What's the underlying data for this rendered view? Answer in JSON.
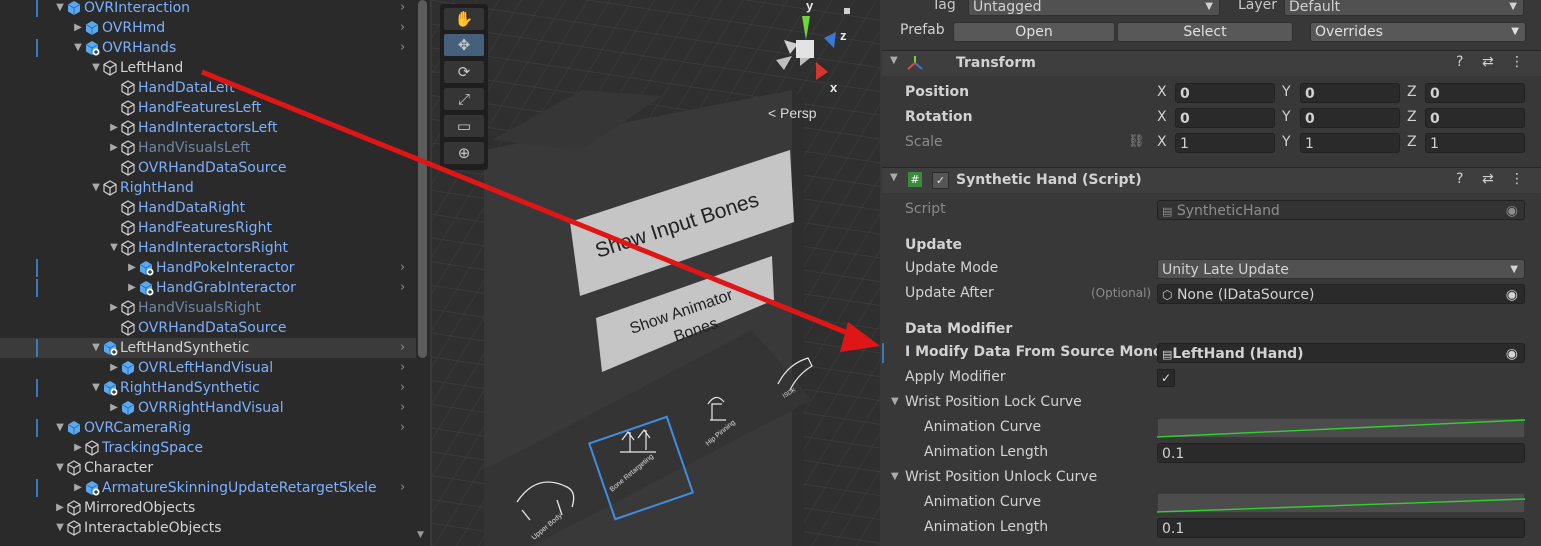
{
  "hierarchy": {
    "items": [
      {
        "label": "OVRInteraction",
        "depth": 0,
        "color": "blue",
        "icon": "prefab",
        "fold": "down",
        "mark": true,
        "chev": true
      },
      {
        "label": "OVRHmd",
        "depth": 1,
        "color": "blue",
        "icon": "prefab",
        "fold": "right",
        "mark": false,
        "chev": true
      },
      {
        "label": "OVRHands",
        "depth": 1,
        "color": "blue",
        "icon": "prefab-variant",
        "fold": "down",
        "mark": true,
        "chev": true
      },
      {
        "label": "LeftHand",
        "depth": 2,
        "color": "white",
        "icon": "gameobject",
        "fold": "down",
        "mark": false,
        "chev": false
      },
      {
        "label": "HandDataLeft",
        "depth": 3,
        "color": "blue",
        "icon": "gameobject",
        "fold": "none",
        "mark": false,
        "chev": false
      },
      {
        "label": "HandFeaturesLeft",
        "depth": 3,
        "color": "blue",
        "icon": "gameobject",
        "fold": "none",
        "mark": false,
        "chev": false
      },
      {
        "label": "HandInteractorsLeft",
        "depth": 3,
        "color": "blue",
        "icon": "gameobject",
        "fold": "right",
        "mark": false,
        "chev": false
      },
      {
        "label": "HandVisualsLeft",
        "depth": 3,
        "color": "gray",
        "icon": "gameobject",
        "fold": "right",
        "mark": false,
        "chev": false
      },
      {
        "label": "OVRHandDataSource",
        "depth": 3,
        "color": "blue",
        "icon": "gameobject",
        "fold": "none",
        "mark": false,
        "chev": false
      },
      {
        "label": "RightHand",
        "depth": 2,
        "color": "blue",
        "icon": "gameobject",
        "fold": "down",
        "mark": false,
        "chev": false
      },
      {
        "label": "HandDataRight",
        "depth": 3,
        "color": "blue",
        "icon": "gameobject",
        "fold": "none",
        "mark": false,
        "chev": false
      },
      {
        "label": "HandFeaturesRight",
        "depth": 3,
        "color": "blue",
        "icon": "gameobject",
        "fold": "none",
        "mark": false,
        "chev": false
      },
      {
        "label": "HandInteractorsRight",
        "depth": 3,
        "color": "blue",
        "icon": "gameobject",
        "fold": "down",
        "mark": false,
        "chev": false
      },
      {
        "label": "HandPokeInteractor",
        "depth": 4,
        "color": "blue",
        "icon": "prefab-added",
        "fold": "right",
        "mark": true,
        "chev": true
      },
      {
        "label": "HandGrabInteractor",
        "depth": 4,
        "color": "blue",
        "icon": "prefab-added",
        "fold": "right",
        "mark": true,
        "chev": true
      },
      {
        "label": "HandVisualsRight",
        "depth": 3,
        "color": "gray",
        "icon": "gameobject",
        "fold": "right",
        "mark": false,
        "chev": false
      },
      {
        "label": "OVRHandDataSource",
        "depth": 3,
        "color": "blue",
        "icon": "gameobject",
        "fold": "none",
        "mark": false,
        "chev": false
      },
      {
        "label": "LeftHandSynthetic",
        "depth": 2,
        "color": "white",
        "icon": "prefab-added",
        "fold": "down",
        "mark": true,
        "chev": true,
        "selected": true
      },
      {
        "label": "OVRLeftHandVisual",
        "depth": 3,
        "color": "blue",
        "icon": "prefab",
        "fold": "right",
        "mark": false,
        "chev": true
      },
      {
        "label": "RightHandSynthetic",
        "depth": 2,
        "color": "blue",
        "icon": "prefab-added",
        "fold": "down",
        "mark": true,
        "chev": true
      },
      {
        "label": "OVRRightHandVisual",
        "depth": 3,
        "color": "blue",
        "icon": "prefab",
        "fold": "right",
        "mark": false,
        "chev": true
      },
      {
        "label": "OVRCameraRig",
        "depth": 0,
        "color": "blue",
        "icon": "prefab",
        "fold": "down",
        "mark": true,
        "chev": true
      },
      {
        "label": "TrackingSpace",
        "depth": 1,
        "color": "blue",
        "icon": "gameobject",
        "fold": "right",
        "mark": false,
        "chev": false
      },
      {
        "label": "Character",
        "depth": 0,
        "color": "white",
        "icon": "gameobject",
        "fold": "down",
        "mark": false,
        "chev": false
      },
      {
        "label": "ArmatureSkinningUpdateRetargetSkele",
        "depth": 1,
        "color": "blue",
        "icon": "prefab-variant",
        "fold": "right",
        "mark": true,
        "chev": true
      },
      {
        "label": "MirroredObjects",
        "depth": 0,
        "color": "white",
        "icon": "gameobject",
        "fold": "right",
        "mark": false,
        "chev": false
      },
      {
        "label": "InteractableObjects",
        "depth": 0,
        "color": "white",
        "icon": "gameobject",
        "fold": "down",
        "mark": false,
        "chev": false
      }
    ]
  },
  "scene": {
    "persp_label": "Persp",
    "gizmo_y": "y",
    "gizmo_z": "z",
    "gizmo_x": "x",
    "panel_top_label": "Show Input Bones",
    "panel_mid_label_1": "Show Animator",
    "panel_mid_label_2": "Bones",
    "thumb_1": "Upper Body",
    "thumb_2": "Bone Retargeting",
    "thumb_3": "Hip Pinning",
    "thumb_4": "ISDK",
    "tools": [
      "hand-icon",
      "move-icon",
      "rotate-icon",
      "scale-icon",
      "rect-icon",
      "transform-icon"
    ]
  },
  "inspector": {
    "tag_label": "Tag",
    "tag_value": "Untagged",
    "layer_label": "Layer",
    "layer_value": "Default",
    "prefab_label": "Prefab",
    "open_label": "Open",
    "select_label": "Select",
    "overrides_label": "Overrides",
    "transform_title": "Transform",
    "position_label": "Position",
    "rotation_label": "Rotation",
    "scale_label": "Scale",
    "axis_x": "X",
    "axis_y": "Y",
    "axis_z": "Z",
    "position": [
      "0",
      "0",
      "0"
    ],
    "rotation": [
      "0",
      "0",
      "0"
    ],
    "scale": [
      "1",
      "1",
      "1"
    ],
    "script_title": "Synthetic Hand (Script)",
    "script_label": "Script",
    "script_value": "SyntheticHand",
    "update_header": "Update",
    "update_mode_label": "Update Mode",
    "update_mode_value": "Unity Late Update",
    "update_after_label": "Update After",
    "optional_label": "(Optional)",
    "update_after_value": "None (IDataSource)",
    "data_modifier_header": "Data Modifier",
    "modify_label": "I Modify Data From Source Mono",
    "modify_value": "LeftHand (Hand)",
    "apply_modifier_label": "Apply Modifier",
    "wrist_lock_label": "Wrist Position Lock Curve",
    "animation_curve_label": "Animation Curve",
    "animation_length_label": "Animation Length",
    "wrist_lock_length": "0.1",
    "wrist_unlock_label": "Wrist Position Unlock Curve",
    "wrist_unlock_length": "0.1",
    "accent_color": "#3a79bb",
    "curve_color": "#2fd12f"
  }
}
